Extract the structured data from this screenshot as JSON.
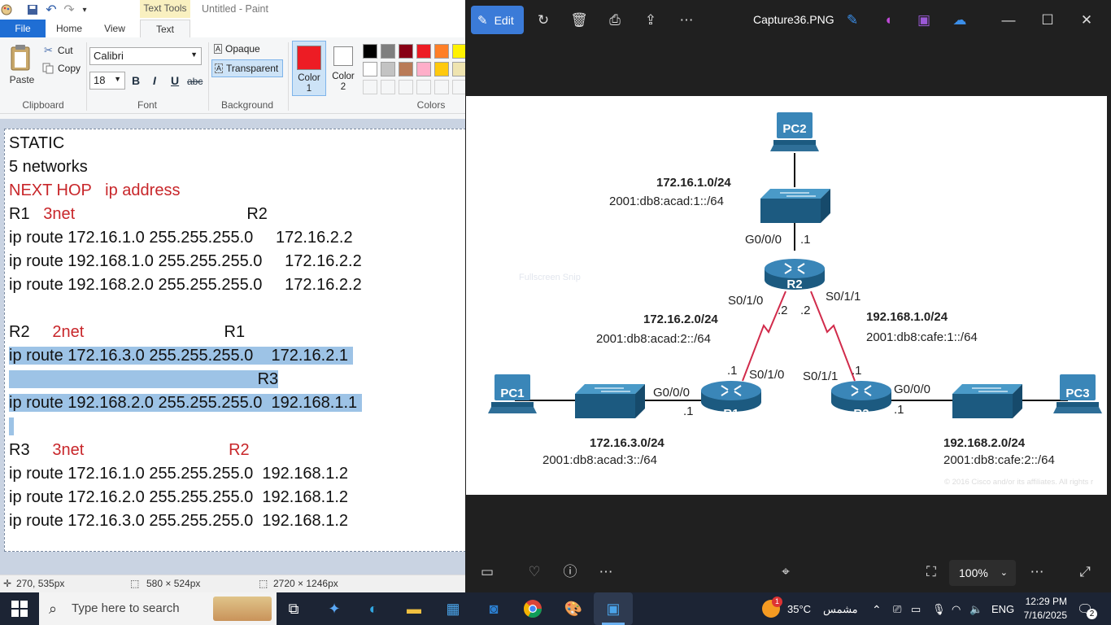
{
  "paint": {
    "window_title": "Untitled - Paint",
    "context_tab": "Text Tools",
    "tabs": {
      "file": "File",
      "home": "Home",
      "view": "View",
      "text": "Text"
    },
    "clipboard": {
      "paste": "Paste",
      "cut": "Cut",
      "copy": "Copy",
      "label": "Clipboard"
    },
    "font": {
      "family": "Calibri",
      "size": "18",
      "bold": "B",
      "italic": "I",
      "underline": "U",
      "strike": "abc",
      "label": "Font"
    },
    "background": {
      "opaque": "Opaque",
      "transparent": "Transparent",
      "label": "Background"
    },
    "colors": {
      "color1": "Color 1",
      "color2": "Color 2",
      "label": "Colors",
      "palette": [
        "#000000",
        "#7f7f7f",
        "#880015",
        "#ed1c24",
        "#ff7f27",
        "#fff200",
        "#ffffff",
        "#c3c3c3",
        "#b97a57",
        "#ffaec9",
        "#ffc90e",
        "#efe4b0"
      ]
    },
    "canvas_lines": [
      {
        "segments": [
          {
            "text": "STATIC",
            "color": "black"
          }
        ]
      },
      {
        "segments": [
          {
            "text": "5 networks",
            "color": "black"
          }
        ]
      },
      {
        "segments": [
          {
            "text": "NEXT HOP   ip address",
            "color": "red"
          }
        ]
      },
      {
        "segments": [
          {
            "text": "R1   ",
            "color": "black"
          },
          {
            "text": "3net",
            "color": "red"
          },
          {
            "text": "                                      R2",
            "color": "black"
          }
        ]
      },
      {
        "segments": [
          {
            "text": "ip route 172.16.1.0 255.255.255.0     172.16.2.2",
            "color": "black"
          }
        ]
      },
      {
        "segments": [
          {
            "text": "ip route 192.168.1.0 255.255.255.0     172.16.2.2",
            "color": "black"
          }
        ]
      },
      {
        "segments": [
          {
            "text": "ip route 192.168.2.0 255.255.255.0     172.16.2.2",
            "color": "black"
          }
        ]
      },
      {
        "segments": [
          {
            "text": "",
            "color": "black"
          }
        ]
      },
      {
        "segments": [
          {
            "text": "R2     ",
            "color": "black"
          },
          {
            "text": "2net",
            "color": "red"
          },
          {
            "text": "                               R1",
            "color": "black"
          }
        ]
      },
      {
        "highlight": true,
        "segments": [
          {
            "text": "ip route 172.16.3.0 255.255.255.0    172.16.2.1 ",
            "color": "black"
          }
        ]
      },
      {
        "highlight": true,
        "segments": [
          {
            "text": "                                                       R3",
            "color": "black"
          }
        ]
      },
      {
        "highlight": true,
        "segments": [
          {
            "text": "ip route 192.168.2.0 255.255.255.0  192.168.1.1 ",
            "color": "black"
          }
        ]
      },
      {
        "highlight": true,
        "segments": [
          {
            "text": " ",
            "color": "black"
          }
        ]
      },
      {
        "segments": [
          {
            "text": "R3     ",
            "color": "black"
          },
          {
            "text": "3net",
            "color": "red"
          },
          {
            "text": "                                ",
            "color": "black"
          },
          {
            "text": "R2",
            "color": "red"
          }
        ]
      },
      {
        "segments": [
          {
            "text": "ip route 172.16.1.0 255.255.255.0  192.168.1.2",
            "color": "black"
          }
        ]
      },
      {
        "segments": [
          {
            "text": "ip route 172.16.2.0 255.255.255.0  192.168.1.2",
            "color": "black"
          }
        ]
      },
      {
        "segments": [
          {
            "text": "ip route 172.16.3.0 255.255.255.0  192.168.1.2",
            "color": "black"
          }
        ]
      }
    ],
    "status": {
      "cursor": "270, 535px",
      "selection": "580 × 524px",
      "size": "2720 × 1246px"
    }
  },
  "photos": {
    "edit_label": "Edit",
    "file_name": "Capture36.PNG",
    "zoom": "100%",
    "faint_overlay": "Fullscreen Snip",
    "diagram": {
      "pc2": "PC2",
      "pc1": "PC1",
      "pc3": "PC3",
      "r1": "R1",
      "r2": "R2",
      "r3": "R3",
      "net_top": "172.16.1.0/24",
      "net_top_v6": "2001:db8:acad:1::/64",
      "net_mid_left": "172.16.2.0/24",
      "net_mid_left_v6": "2001:db8:acad:2::/64",
      "net_mid_right": "192.168.1.0/24",
      "net_mid_right_v6": "2001:db8:cafe:1::/64",
      "net_bottom_left": "172.16.3.0/24",
      "net_bottom_left_v6": "2001:db8:acad:3::/64",
      "net_bottom_right": "192.168.2.0/24",
      "net_bottom_right_v6": "2001:db8:cafe:2::/64",
      "r2_g": "G0/0/0",
      "r2_g_ip": ".1",
      "r2_s0": "S0/1/0",
      "r2_s0_ip": ".2",
      "r2_s1": "S0/1/1",
      "r2_s1_ip": ".2",
      "r1_s": "S0/1/0",
      "r1_s_ip": ".1",
      "r1_g": "G0/0/0",
      "r1_g_ip": ".1",
      "r3_s": "S0/1/1",
      "r3_s_ip": ".1",
      "r3_g": "G0/0/0",
      "r3_g_ip": ".1",
      "copyright": "© 2016  Cisco and/or its affiliates. All rights r"
    }
  },
  "taskbar": {
    "search_placeholder": "Type here to search",
    "weather": "35°C",
    "weather_desc": "مشمس",
    "weather_badge": "1",
    "lang": "ENG",
    "time": "12:29 PM",
    "date": "7/16/2025",
    "notification_count": "2"
  }
}
